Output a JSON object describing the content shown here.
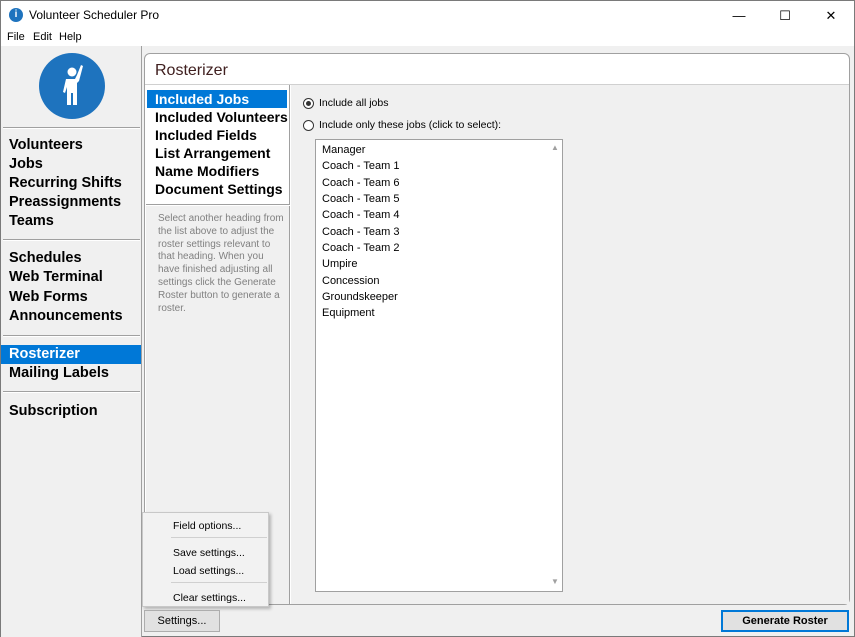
{
  "app": {
    "title": "Volunteer Scheduler Pro"
  },
  "titlebar": {
    "minimize": "—",
    "maximize": "☐",
    "close": "✕"
  },
  "menu": [
    "File",
    "Edit",
    "Help"
  ],
  "nav": {
    "group1": [
      "Volunteers",
      "Jobs",
      "Recurring Shifts",
      "Preassignments",
      "Teams"
    ],
    "group2": [
      "Schedules",
      "Web Terminal",
      "Web Forms",
      "Announcements"
    ],
    "group3": [
      "Rosterizer",
      "Mailing Labels"
    ],
    "group4": [
      "Subscription"
    ],
    "selected": "Rosterizer"
  },
  "panel": {
    "title": "Rosterizer",
    "headings": [
      "Included Jobs",
      "Included Volunteers",
      "Included Fields",
      "List Arrangement",
      "Name Modifiers",
      "Document Settings"
    ],
    "selected_heading": "Included Jobs",
    "help_text": "Select another heading from the list above to adjust the roster settings relevant to that heading. When you have finished adjusting all settings click the Generate Roster button to generate a roster."
  },
  "options": {
    "include_all": "Include all jobs",
    "include_only": "Include only these jobs (click to select):",
    "selected": "include_all"
  },
  "jobs": [
    "Manager",
    "Coach - Team 1",
    "Coach - Team 6",
    "Coach - Team 5",
    "Coach - Team 4",
    "Coach - Team 3",
    "Coach - Team 2",
    "Umpire",
    "Concession",
    "Groundskeeper",
    "Equipment"
  ],
  "popup_menu": {
    "field_options": "Field options...",
    "save_settings": "Save settings...",
    "load_settings": "Load settings...",
    "clear_settings": "Clear settings..."
  },
  "buttons": {
    "settings": "Settings...",
    "generate": "Generate Roster"
  },
  "colors": {
    "accent": "#0078d7",
    "logo": "#1e73be"
  }
}
